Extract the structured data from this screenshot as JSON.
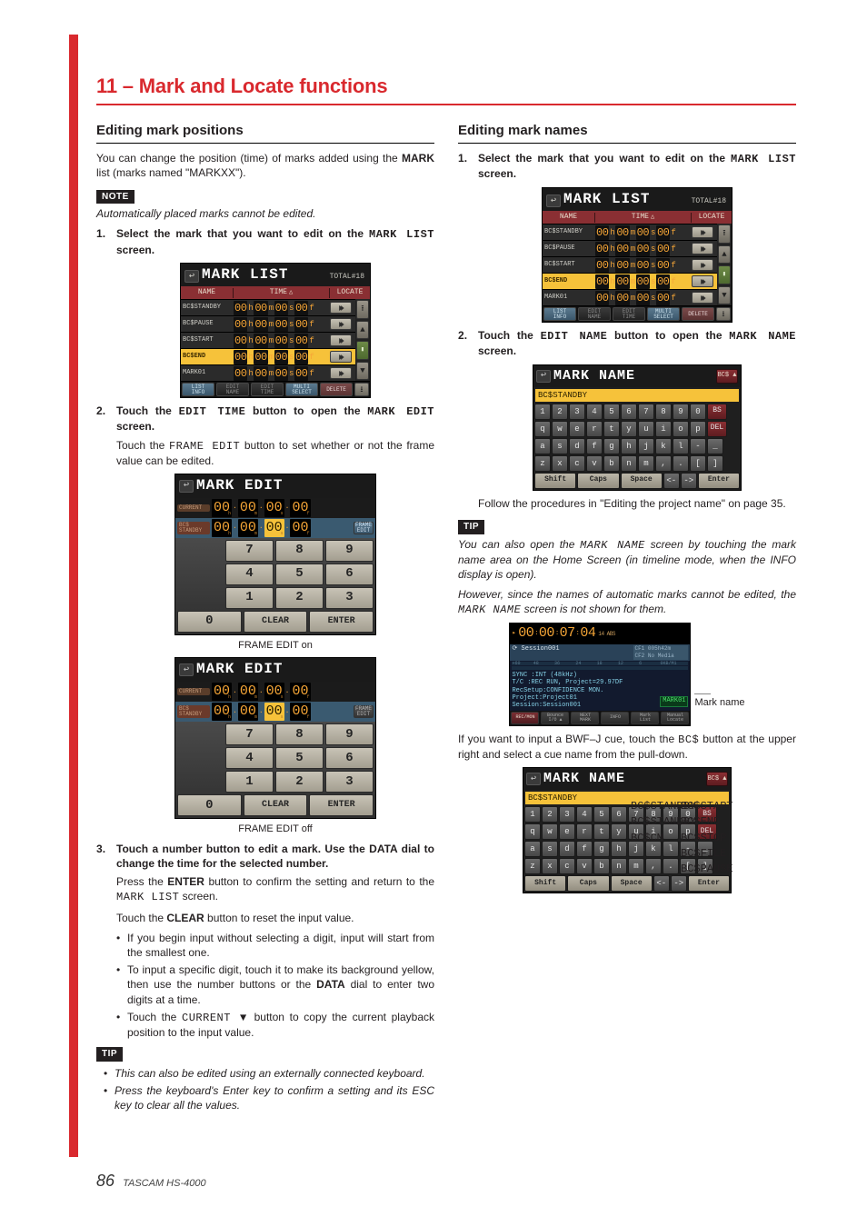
{
  "chapter": "11 – Mark and Locate functions",
  "left": {
    "heading": "Editing mark positions",
    "intro_a": "You can change the position (time) of marks added using the ",
    "intro_b": "MARK",
    "intro_c": " list (marks named \"MARKXX\").",
    "note_label": "NOTE",
    "note_text": "Automatically placed marks cannot be edited.",
    "step1_a": "Select the mark that you want to edit on the ",
    "step1_b": "MARK LIST",
    "step1_c": " screen.",
    "step2_a": "Touch the ",
    "step2_b": "EDIT TIME",
    "step2_c": " button to open the ",
    "step2_d": "MARK EDIT",
    "step2_e": " screen.",
    "step2_p_a": "Touch the ",
    "step2_p_b": "FRAME EDIT",
    "step2_p_c": " button to set whether or not the frame value can be edited.",
    "cap_on": "FRAME EDIT on",
    "cap_off": "FRAME EDIT off",
    "step3_title": "Touch a number button to edit a mark. Use the DATA dial to change the time for the selected number.",
    "step3_p_a": "Press the ",
    "step3_p_b": "ENTER",
    "step3_p_c": " button to confirm the setting and return to the ",
    "step3_p_d": "MARK LIST",
    "step3_p_e": " screen.",
    "step3_p2_a": "Touch the ",
    "step3_p2_b": "CLEAR",
    "step3_p2_c": " button to reset the input value.",
    "bul1": "If you begin input without selecting a digit, input will start from the smallest one.",
    "bul2_a": "To input a specific digit, touch it to make its background yellow, then use the number buttons or the ",
    "bul2_b": "DATA",
    "bul2_c": " dial to enter two digits at a time.",
    "bul3_a": "Touch the ",
    "bul3_b": "CURRENT ▼",
    "bul3_c": " button to copy the current playback position to the input value.",
    "tip_label": "TIP",
    "tip1": "This can also be edited using an externally connected keyboard.",
    "tip2": "Press the keyboard's Enter key to confirm a setting and its ESC key to clear all the values."
  },
  "right": {
    "heading": "Editing mark names",
    "step1_a": "Select the mark that you want to edit on the ",
    "step1_b": "MARK LIST",
    "step1_c": " screen.",
    "step2_a": "Touch the ",
    "step2_b": "EDIT NAME",
    "step2_c": " button to open the ",
    "step2_d": "MARK NAME",
    "step2_e": " screen.",
    "follow": "Follow the procedures in \"Editing the project name\" on page 35.",
    "tip_label": "TIP",
    "tip_p1_a": "You can also open the ",
    "tip_p1_b": "MARK NAME",
    "tip_p1_c": " screen by touching the mark name area on the Home Screen (in timeline mode, when the INFO display is open).",
    "tip_p2_a": "However, since the names of automatic marks cannot be edited, the ",
    "tip_p2_b": "MARK NAME",
    "tip_p2_c": " screen is not shown for them.",
    "callout": "Mark name",
    "if_a": "If you want to input a BWF–J cue, touch the ",
    "if_b": "BC$",
    "if_c": " button at the upper right and select a cue name from the pull-down."
  },
  "marklist": {
    "title": "MARK LIST",
    "total": "TOTAL#18",
    "col_name": "NAME",
    "col_time": "TIME",
    "col_locate": "LOCATE",
    "rows": [
      {
        "name": "BC$STANDBY",
        "sel": false
      },
      {
        "name": "BC$PAUSE",
        "sel": false
      },
      {
        "name": "BC$START",
        "sel": false
      },
      {
        "name": "BC$END",
        "sel": true
      },
      {
        "name": "MARK01",
        "sel": false
      }
    ],
    "foot": [
      "LIST INFO",
      "EDIT NAME",
      "EDIT TIME",
      "MULTI SELECT",
      "DELETE"
    ]
  },
  "markedit": {
    "title": "MARK EDIT",
    "current": "CURRENT",
    "bcs": "BC$ STANDBY",
    "frame": "FRAME EDIT",
    "keys": [
      [
        "7",
        "8",
        "9"
      ],
      [
        "4",
        "5",
        "6"
      ],
      [
        "1",
        "2",
        "3"
      ],
      [
        "0",
        "CLEAR",
        "ENTER"
      ]
    ],
    "subs": [
      "h",
      "m",
      "s",
      "f"
    ]
  },
  "markname": {
    "title": "MARK NAME",
    "bcs_btn": "BC$ ▲",
    "field": "BC$STANDBY",
    "rows": [
      [
        "1",
        "2",
        "3",
        "4",
        "5",
        "6",
        "7",
        "8",
        "9",
        "0",
        "BS"
      ],
      [
        "q",
        "w",
        "e",
        "r",
        "t",
        "y",
        "u",
        "i",
        "o",
        "p",
        "DEL"
      ],
      [
        "a",
        "s",
        "d",
        "f",
        "g",
        "h",
        "j",
        "k",
        "l",
        "-",
        "_"
      ],
      [
        "z",
        "x",
        "c",
        "v",
        "b",
        "n",
        "m",
        ",",
        ".",
        "[",
        "]"
      ]
    ],
    "bottom": [
      "Shift",
      "Caps",
      "Space",
      "<-",
      "->",
      "Enter"
    ],
    "cues_left": [
      "BC$STANDBY",
      "BC$STANDBY",
      "BC$CM",
      "",
      ""
    ],
    "cues_right": [
      "BC$START",
      "BC$END",
      "BC$STOP",
      "BC$FILE",
      "BC$PAUSE"
    ]
  },
  "home": {
    "tc": "00 00 07 04",
    "tc_sub": "14 ABS",
    "session": "Session001",
    "cf1": "CF1 005h42m",
    "cf2": "CF2 No Media",
    "ticks": [
      "+60",
      "48",
      "36",
      "24",
      "18",
      "12",
      "6",
      "0KB/M1"
    ],
    "sync1": "SYNC  :INT (48kHz)",
    "sync2": "T/C   :REC RUN, Project=29.97DF",
    "sync3": "RecSetup:CONFIDENCE MON.",
    "sync4": "Project:Project01",
    "sync5": "Session:Session001",
    "mark": "MARK01",
    "foot": [
      "REC/MON",
      "Bounce I/O ▲",
      "NEXT MARK",
      "INFO",
      "Mark List",
      "Manual Locate"
    ]
  },
  "footer": {
    "page": "86",
    "model": "TASCAM HS-4000"
  }
}
